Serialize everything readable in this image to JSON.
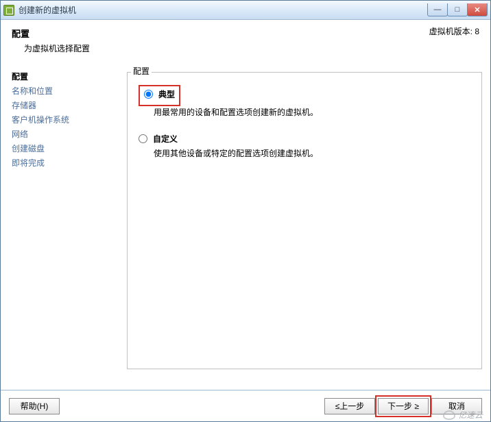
{
  "titlebar": {
    "title": "创建新的虚拟机"
  },
  "header": {
    "title": "配置",
    "subtitle": "为虚拟机选择配置",
    "version": "虚拟机版本: 8"
  },
  "sidebar": {
    "items": [
      {
        "label": "配置",
        "current": true
      },
      {
        "label": "名称和位置",
        "current": false
      },
      {
        "label": "存储器",
        "current": false
      },
      {
        "label": "客户机操作系统",
        "current": false
      },
      {
        "label": "网络",
        "current": false
      },
      {
        "label": "创建磁盘",
        "current": false
      },
      {
        "label": "即将完成",
        "current": false
      }
    ]
  },
  "panel": {
    "legend": "配置",
    "options": [
      {
        "label": "典型",
        "desc": "用最常用的设备和配置选项创建新的虚拟机。",
        "selected": true,
        "highlighted": true
      },
      {
        "label": "自定义",
        "desc": "使用其他设备或特定的配置选项创建虚拟机。",
        "selected": false,
        "highlighted": false
      }
    ]
  },
  "footer": {
    "help": "帮助(H)",
    "back": "≤上一步",
    "next": "下一步 ≥",
    "cancel": "取消",
    "next_highlighted": true
  },
  "watermark": "亿速云"
}
